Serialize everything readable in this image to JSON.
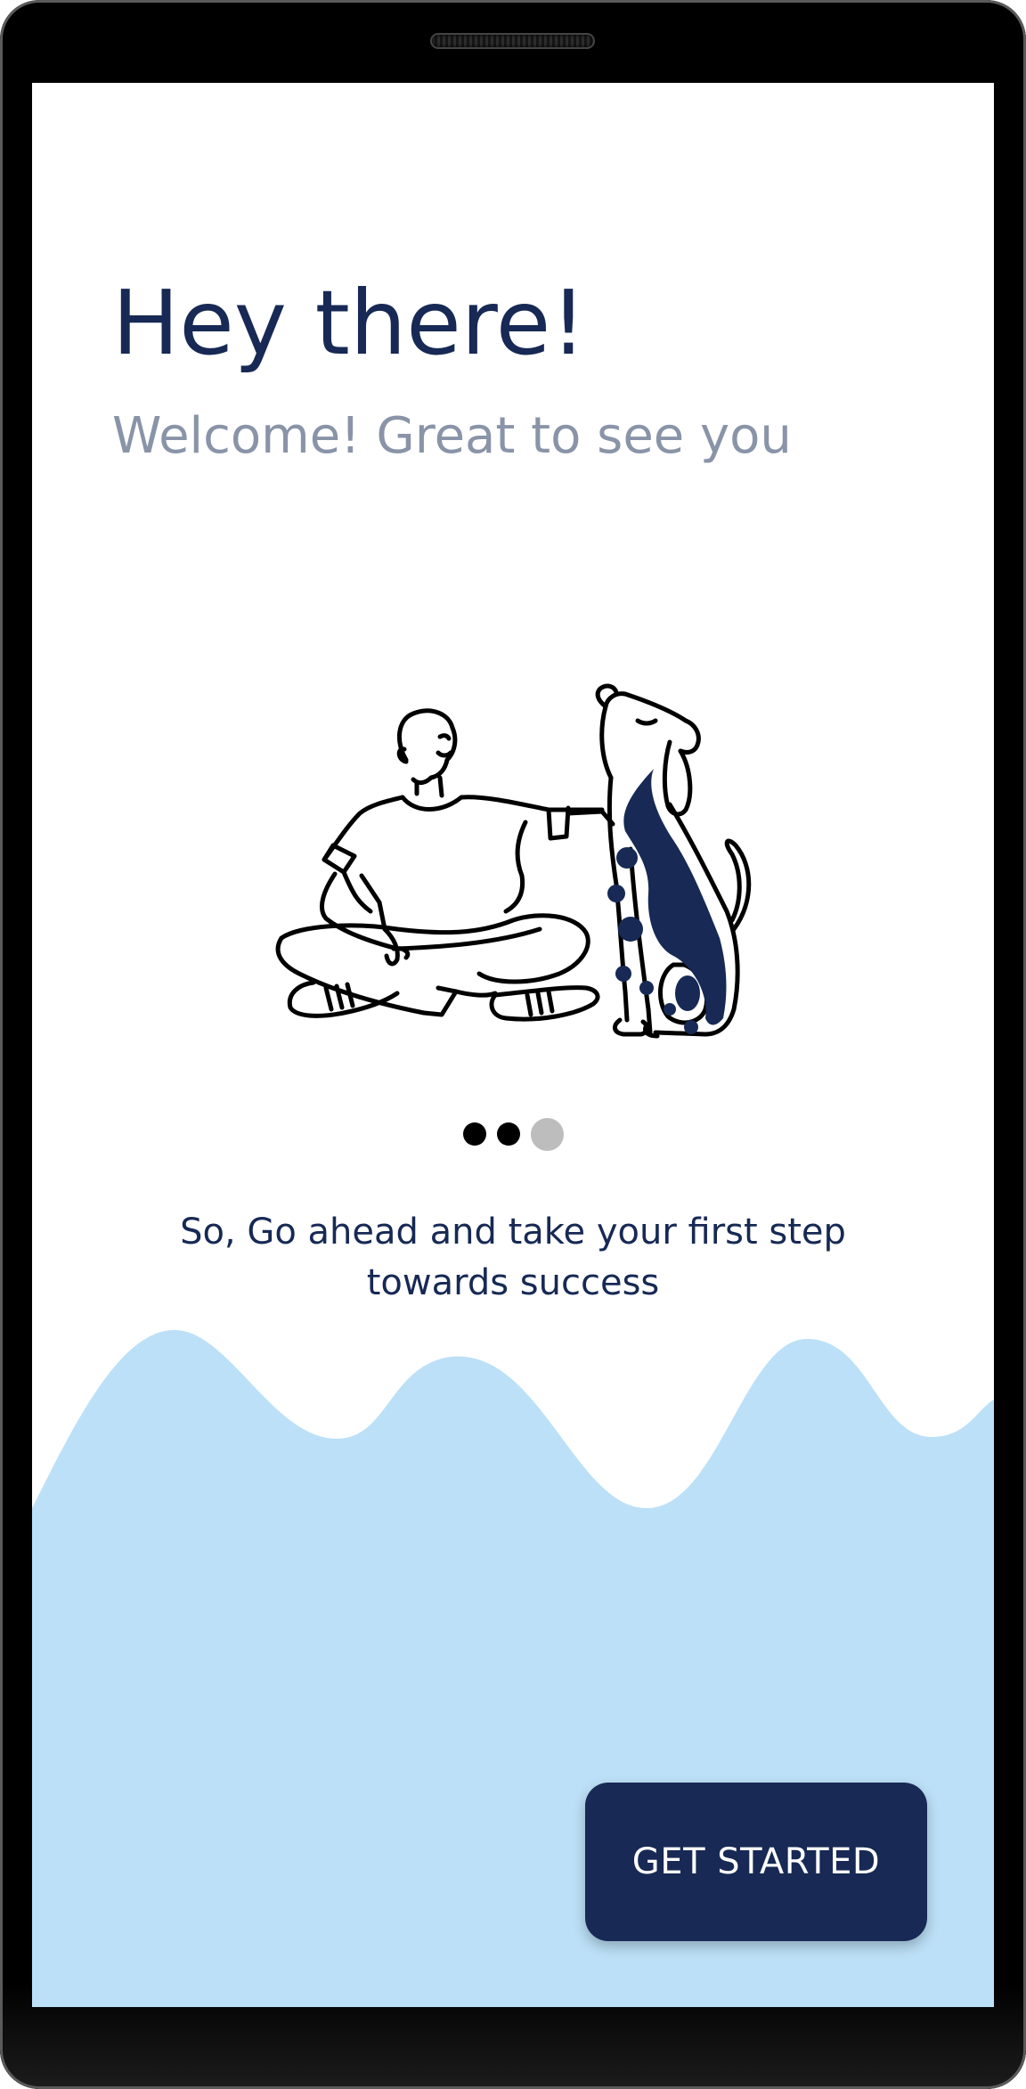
{
  "onboarding": {
    "title": "Hey there!",
    "subtitle": "Welcome! Great to see you",
    "illustration_icon": "man-with-dog-illustration",
    "pagination": {
      "total": 3,
      "active_index": 2
    },
    "tagline": "So, Go ahead and take your first step towards success",
    "cta_label": "GET STARTED"
  },
  "colors": {
    "primary": "#172954",
    "subtitle": "#8a94a8",
    "wave": "#bce0f7",
    "dot_active": "#000000",
    "dot_inactive": "#bdbdbd",
    "background": "#ffffff"
  }
}
